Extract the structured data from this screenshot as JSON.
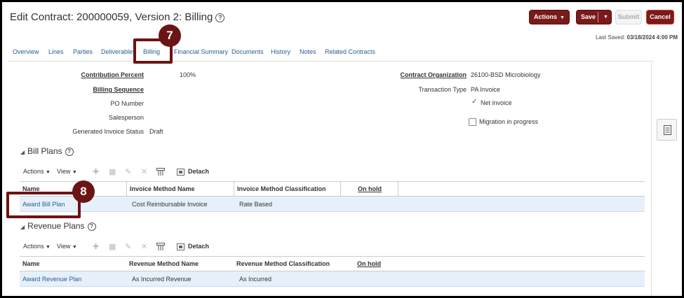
{
  "header": {
    "title": "Edit Contract: 200000059, Version 2: Billing",
    "last_saved_label": "Last Saved:",
    "last_saved_value": "03/18/2024 4:00 PM"
  },
  "buttons": {
    "actions": "Actions",
    "save": "Save",
    "submit": "Submit",
    "cancel": "Cancel"
  },
  "tabs": [
    "Overview",
    "Lines",
    "Parties",
    "Deliverables",
    "Billing",
    "Financial Summary",
    "Documents",
    "History",
    "Notes",
    "Related Contracts"
  ],
  "callouts": {
    "step7": "7",
    "step8": "8"
  },
  "form": {
    "contribution_percent_label": "Contribution Percent",
    "contribution_percent_value": "100%",
    "billing_sequence_label": "Billing Sequence",
    "po_number_label": "PO Number",
    "salesperson_label": "Salesperson",
    "invoice_status_label": "Generated Invoice Status",
    "invoice_status_value": "Draft",
    "contract_org_label": "Contract Organization",
    "contract_org_value": "26100-BSD Microbiology",
    "transaction_type_label": "Transaction Type",
    "transaction_type_value": "PA Invoice",
    "net_invoice_label": "Net invoice",
    "migration_label": "Migration in progress"
  },
  "bill_plans": {
    "title": "Bill Plans",
    "toolbar": {
      "actions": "Actions",
      "view": "View",
      "detach": "Detach"
    },
    "columns": [
      "Name",
      "Invoice Method Name",
      "Invoice Method Classification",
      "On hold"
    ],
    "rows": [
      {
        "name": "Award Bill Plan",
        "method": "Cost Reimbursable Invoice",
        "classification": "Rate Based",
        "on_hold": ""
      }
    ]
  },
  "revenue_plans": {
    "title": "Revenue Plans",
    "toolbar": {
      "actions": "Actions",
      "view": "View",
      "detach": "Detach"
    },
    "columns": [
      "Name",
      "Revenue Method Name",
      "Revenue Method Classification",
      "On hold"
    ],
    "rows": [
      {
        "name": "Award Revenue Plan",
        "method": "As Incurred Revenue",
        "classification": "As Incurred",
        "on_hold": ""
      }
    ]
  },
  "icons": [
    "help-icon",
    "chevron-down-icon",
    "add-icon",
    "delete-icon",
    "edit-icon",
    "remove-icon",
    "columns-icon",
    "detach-icon",
    "side-panel-icon",
    "check-icon"
  ],
  "colors": {
    "accent": "#7a1a1a",
    "link": "#2a5d94",
    "selected_row": "#e6f0fa",
    "callout": "#6b1414"
  }
}
